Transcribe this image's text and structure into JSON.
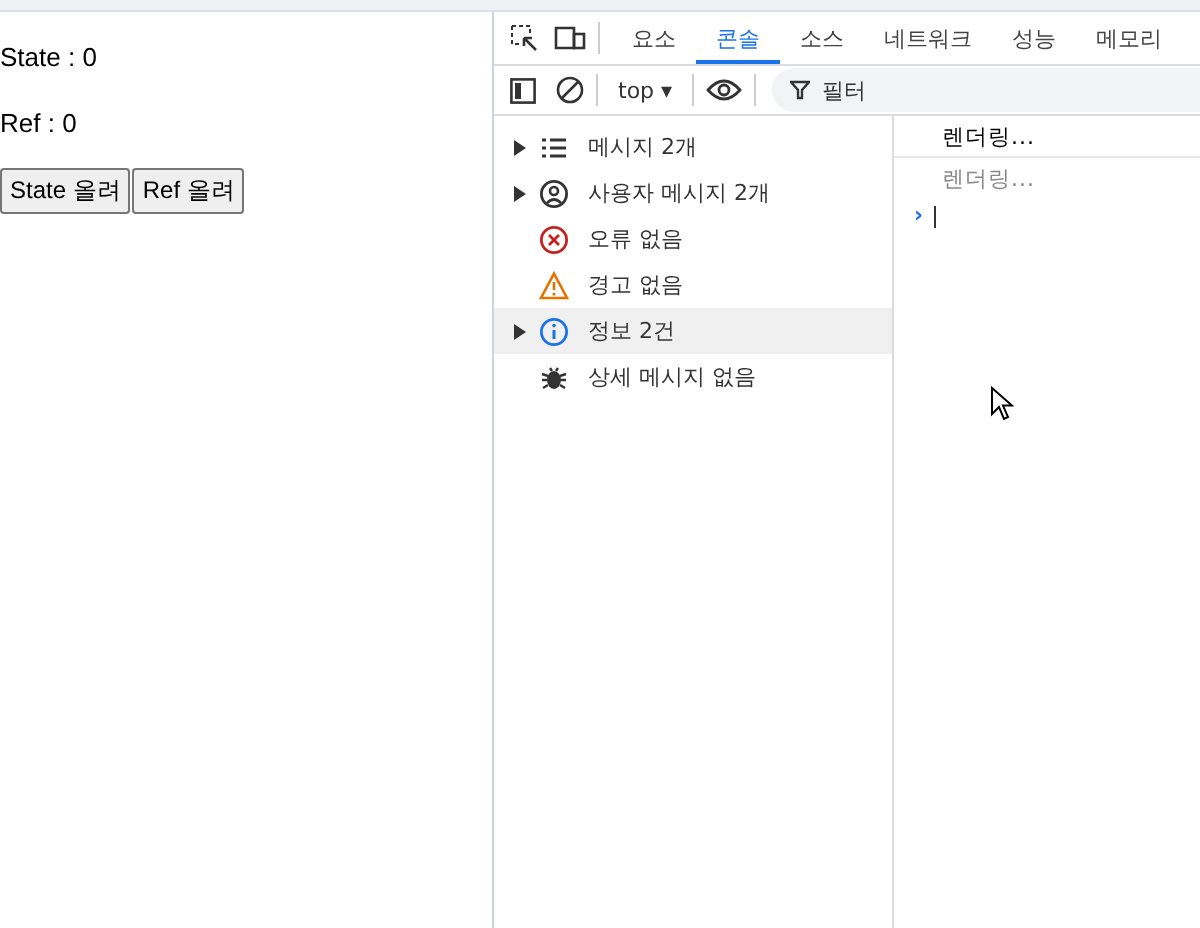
{
  "page": {
    "lines": [
      "State : 0",
      "Ref : 0"
    ],
    "buttons": [
      "State 올려",
      "Ref 올려"
    ]
  },
  "devtools": {
    "tabs": [
      {
        "label": "요소",
        "selected": false
      },
      {
        "label": "콘솔",
        "selected": true
      },
      {
        "label": "소스",
        "selected": false
      },
      {
        "label": "네트워크",
        "selected": false
      },
      {
        "label": "성능",
        "selected": false
      },
      {
        "label": "메모리",
        "selected": false
      }
    ],
    "context": "top ▾",
    "filter": {
      "placeholder": "필터"
    },
    "sidebar": [
      {
        "label": "메시지 2개",
        "kind": "list",
        "expandable": true,
        "selected": false
      },
      {
        "label": "사용자 메시지 2개",
        "kind": "user",
        "expandable": true,
        "selected": false
      },
      {
        "label": "오류 없음",
        "kind": "error",
        "expandable": false,
        "selected": false
      },
      {
        "label": "경고 없음",
        "kind": "warning",
        "expandable": false,
        "selected": false
      },
      {
        "label": "정보 2건",
        "kind": "info",
        "expandable": true,
        "selected": true
      },
      {
        "label": "상세 메시지 없음",
        "kind": "verbose",
        "expandable": false,
        "selected": false
      }
    ],
    "messages": [
      {
        "text": "렌더링...",
        "dimmed": false
      },
      {
        "text": "렌더링...",
        "dimmed": true
      }
    ],
    "prompt": "›"
  }
}
